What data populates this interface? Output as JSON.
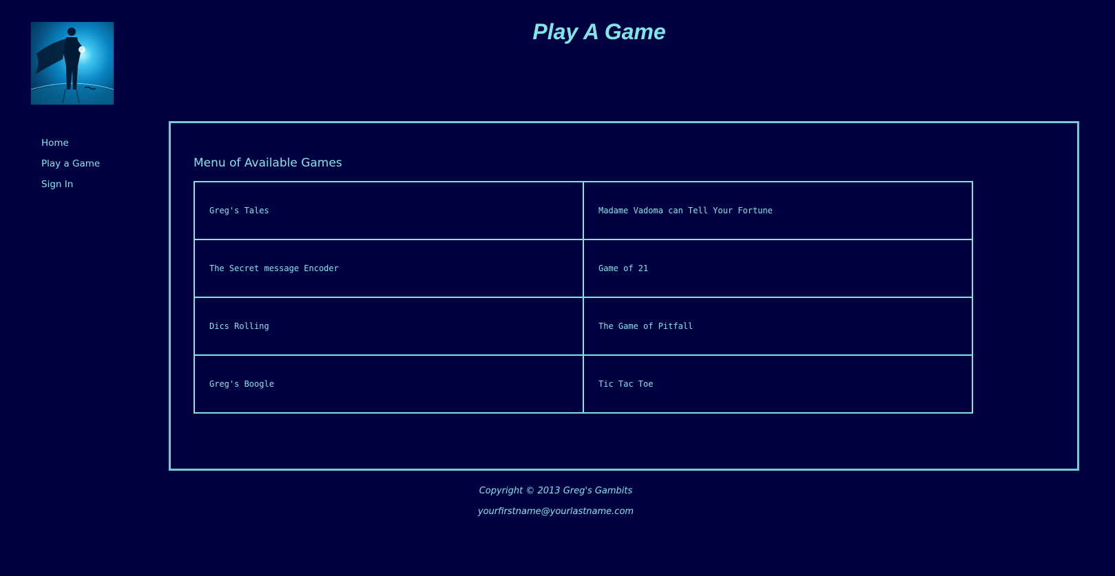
{
  "header": {
    "title": "Play A Game",
    "logo_watermark": "stock"
  },
  "nav": {
    "items": [
      {
        "label": "Home"
      },
      {
        "label": "Play a Game"
      },
      {
        "label": "Sign In"
      }
    ]
  },
  "main": {
    "heading": "Menu of Available Games",
    "games": [
      [
        "Greg's Tales",
        "Madame Vadoma can Tell Your Fortune"
      ],
      [
        "The Secret message Encoder",
        "Game of 21"
      ],
      [
        "Dics Rolling",
        "The Game of Pitfall"
      ],
      [
        "Greg's Boogle",
        "Tic Tac Toe"
      ]
    ]
  },
  "footer": {
    "copyright": "Copyright © 2013 Greg's Gambits",
    "email": "yourfirstname@yourlastname.com"
  },
  "colors": {
    "background": "#000040",
    "text": "#7fe6e6",
    "border": "#6fcfcf"
  }
}
